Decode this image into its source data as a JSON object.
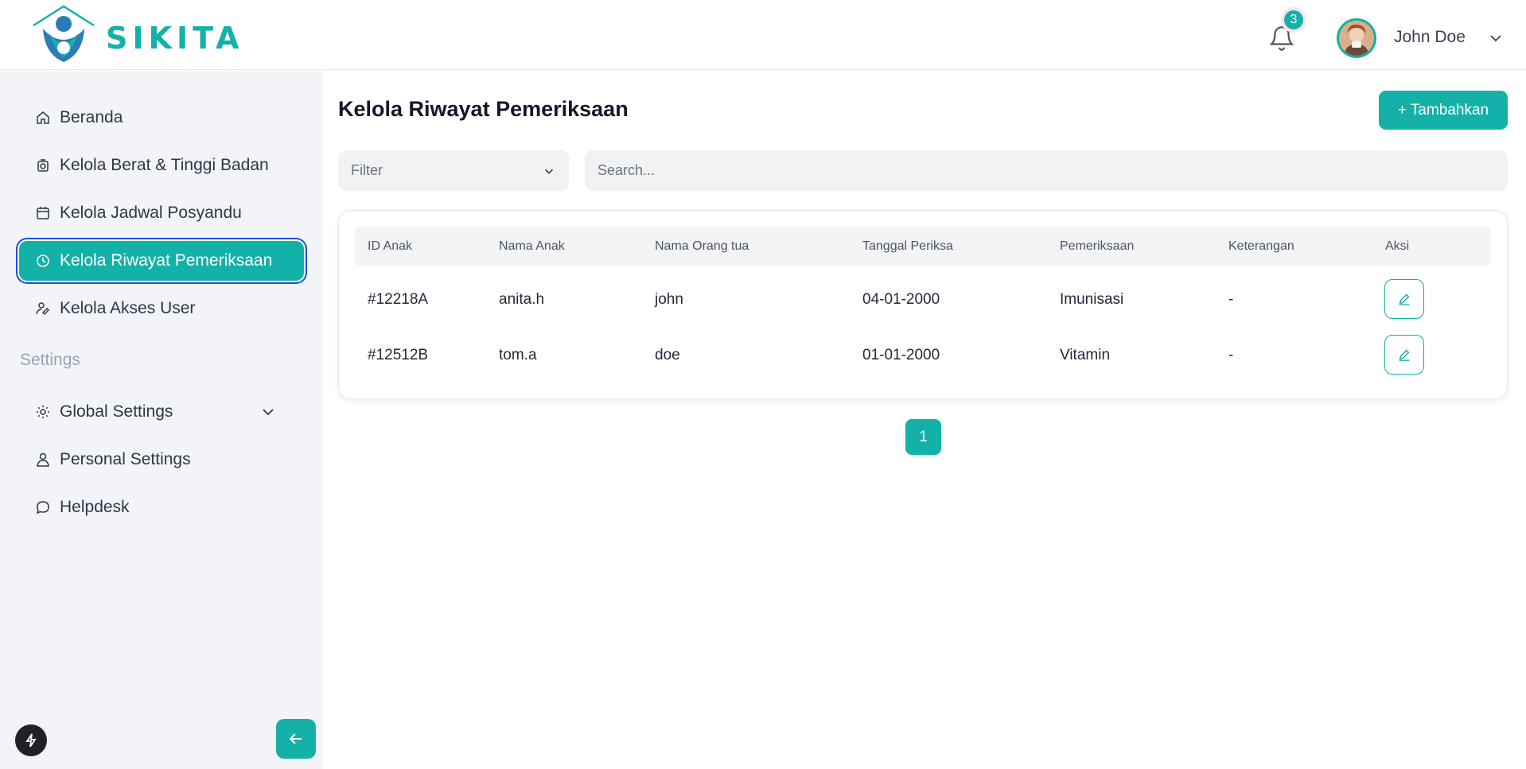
{
  "app": {
    "brand": "SIKITA"
  },
  "header": {
    "notification_count": "3",
    "user_name": "John Doe"
  },
  "sidebar": {
    "items": [
      {
        "label": "Beranda"
      },
      {
        "label": "Kelola Berat & Tinggi Badan"
      },
      {
        "label": "Kelola Jadwal Posyandu"
      },
      {
        "label": "Kelola Riwayat Pemeriksaan"
      },
      {
        "label": "Kelola Akses User"
      }
    ],
    "settings_label": "Settings",
    "settings_items": [
      {
        "label": "Global Settings"
      },
      {
        "label": "Personal Settings"
      },
      {
        "label": "Helpdesk"
      }
    ]
  },
  "main": {
    "title": "Kelola Riwayat Pemeriksaan",
    "add_button": "+ Tambahkan",
    "filter_label": "Filter",
    "search_placeholder": "Search...",
    "columns": [
      "ID Anak",
      "Nama Anak",
      "Nama Orang tua",
      "Tanggal Periksa",
      "Pemeriksaan",
      "Keterangan",
      "Aksi"
    ],
    "rows": [
      {
        "id": "#12218A",
        "nama_anak": "anita.h",
        "orang_tua": "john",
        "tanggal": "04-01-2000",
        "pemeriksaan": "Imunisasi",
        "keterangan": "-"
      },
      {
        "id": "#12512B",
        "nama_anak": "tom.a",
        "orang_tua": "doe",
        "tanggal": "01-01-2000",
        "pemeriksaan": "Vitamin",
        "keterangan": "-"
      }
    ],
    "pagination": {
      "current_page": "1"
    }
  },
  "colors": {
    "accent": "#14b1a9",
    "sidebar_bg": "#f3f4f8",
    "focus_ring": "#1d4ed8"
  }
}
